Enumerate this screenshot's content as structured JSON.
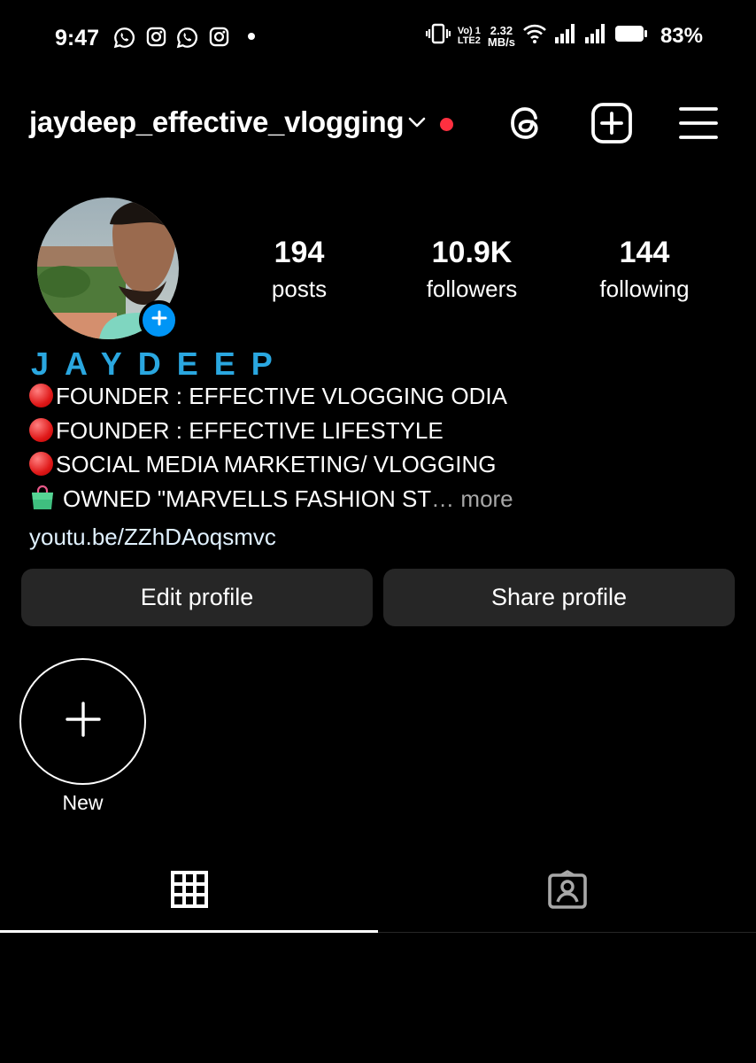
{
  "status_bar": {
    "time": "9:47",
    "notification_icons": [
      "whatsapp-icon",
      "instagram-icon",
      "whatsapp-icon",
      "instagram-icon",
      "more-dot-icon"
    ],
    "network_label_top": "Vo) 1",
    "network_label_bottom": "LTE2",
    "speed_value": "2.32",
    "speed_unit": "MB/s",
    "battery_percent": "83%"
  },
  "header": {
    "username": "jaydeep_effective_vlogging",
    "icons": [
      "chevron-down-icon",
      "threads-icon",
      "create-post-icon",
      "menu-icon"
    ],
    "notification_dot_color": "#ff3040"
  },
  "profile": {
    "stats": [
      {
        "value": "194",
        "label": "posts"
      },
      {
        "value": "10.9K",
        "label": "followers"
      },
      {
        "value": "144",
        "label": "following"
      }
    ],
    "display_name": "JAYDEEP",
    "display_name_color": "#2aa7e0",
    "bio_lines": [
      "FOUNDER : EFFECTIVE VLOGGING ODIA",
      "FOUNDER : EFFECTIVE LIFESTYLE",
      "SOCIAL MEDIA MARKETING/ VLOGGING",
      "OWNED \"MARVELLS FASHION ST"
    ],
    "bio_ellipsis": "…",
    "more_label": "more",
    "link": "youtu.be/ZZhDAoqsmvc"
  },
  "actions": {
    "edit_profile": "Edit profile",
    "share_profile": "Share profile"
  },
  "highlights": {
    "new_label": "New"
  },
  "tabs": {
    "items": [
      "grid-icon",
      "tagged-icon"
    ],
    "active": "grid-icon"
  },
  "colors": {
    "accent_blue": "#0095f6",
    "button_bg": "#262626"
  }
}
